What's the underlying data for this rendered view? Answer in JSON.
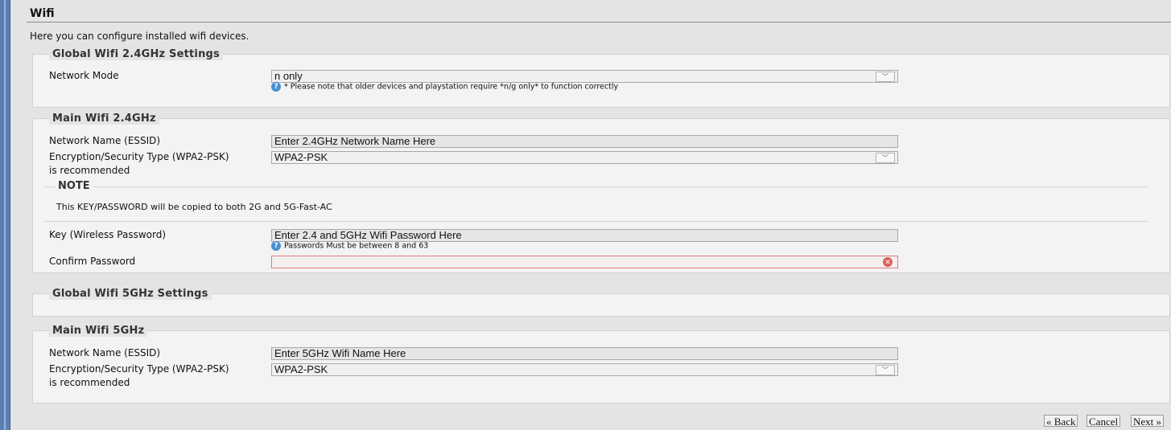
{
  "page": {
    "title": "Wifi",
    "intro": "Here you can configure installed wifi devices."
  },
  "global24": {
    "legend": "Global Wifi 2.4GHz Settings",
    "network_mode_label": "Network Mode",
    "network_mode_value": "n only",
    "network_mode_hint": "* Please note that older devices and playstation require *n/g only* to function correctly"
  },
  "main24": {
    "legend": "Main Wifi 2.4GHz",
    "ssid_label": "Network Name (ESSID)",
    "ssid_value": "Enter 2.4GHz Network Name Here",
    "enc_label_line1": "Encryption/Security Type (WPA2-PSK)",
    "enc_label_line2": "is recommended",
    "enc_value": "WPA2-PSK",
    "note_legend": "NOTE",
    "note_text": "This KEY/PASSWORD will be copied to both 2G and 5G-Fast-AC",
    "key_label": "Key (Wireless Password)",
    "key_value": "Enter 2.4 and 5GHz Wifi Password Here",
    "key_hint": "Passwords Must be between 8 and 63",
    "confirm_label": "Confirm Password",
    "confirm_value": ""
  },
  "global5": {
    "legend": "Global Wifi 5GHz Settings"
  },
  "main5": {
    "legend": "Main Wifi 5GHz",
    "ssid_label": "Network Name (ESSID)",
    "ssid_value": "Enter 5GHz Wifi Name Here",
    "enc_label_line1": "Encryption/Security Type (WPA2-PSK)",
    "enc_label_line2": "is recommended",
    "enc_value": "WPA2-PSK"
  },
  "nav": {
    "back": "« Back",
    "cancel": "Cancel",
    "next": "Next »"
  },
  "icons": {
    "help": "help-icon",
    "error": "error-icon",
    "dropdown": "chevron-down-icon"
  },
  "colors": {
    "background": "#e4e4e4",
    "panel": "#f3f3f3",
    "error_border": "#e07a7a",
    "help_icon": "#4a8fd1",
    "left_edge": "#5b7fb3"
  }
}
